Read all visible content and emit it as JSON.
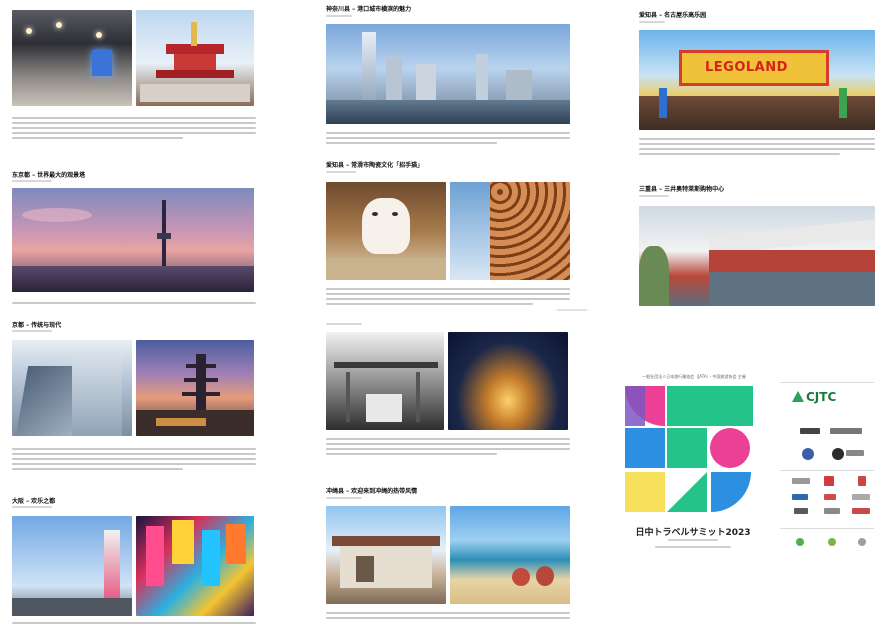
{
  "col1": {
    "s2_title": "东京都 – 世界最大的观景塔",
    "s3_title": "京都 – 传统与现代",
    "s4_title": "大阪 – 欢乐之都"
  },
  "col2": {
    "s1_title": "神奈川县 – 港口城市横滨的魅力",
    "s2_title": "爱知县 – 常滑市陶瓷文化「招手猫」",
    "s4_title": "冲绳县 – 欢迎来到冲绳的热带风情"
  },
  "col3": {
    "s1_title": "爱知县 – 名古屋乐高乐园",
    "s1_photo_text": "LEGOLAND",
    "s2_title": "三重县 – 三井奥特莱斯购物中心"
  },
  "summit": {
    "caption": "一般社団法人日本旅行業協会（JATA）・中国旅游协会 主催",
    "name": "日中トラベルサミット2023"
  },
  "sponsors": {
    "cjtc": "CJTC"
  },
  "colors": {
    "summit_green": "#23c38a",
    "summit_pink": "#ec3f96",
    "summit_blue": "#2d8fe0",
    "summit_yellow": "#f6df5a",
    "summit_purple": "#7e57c2"
  }
}
